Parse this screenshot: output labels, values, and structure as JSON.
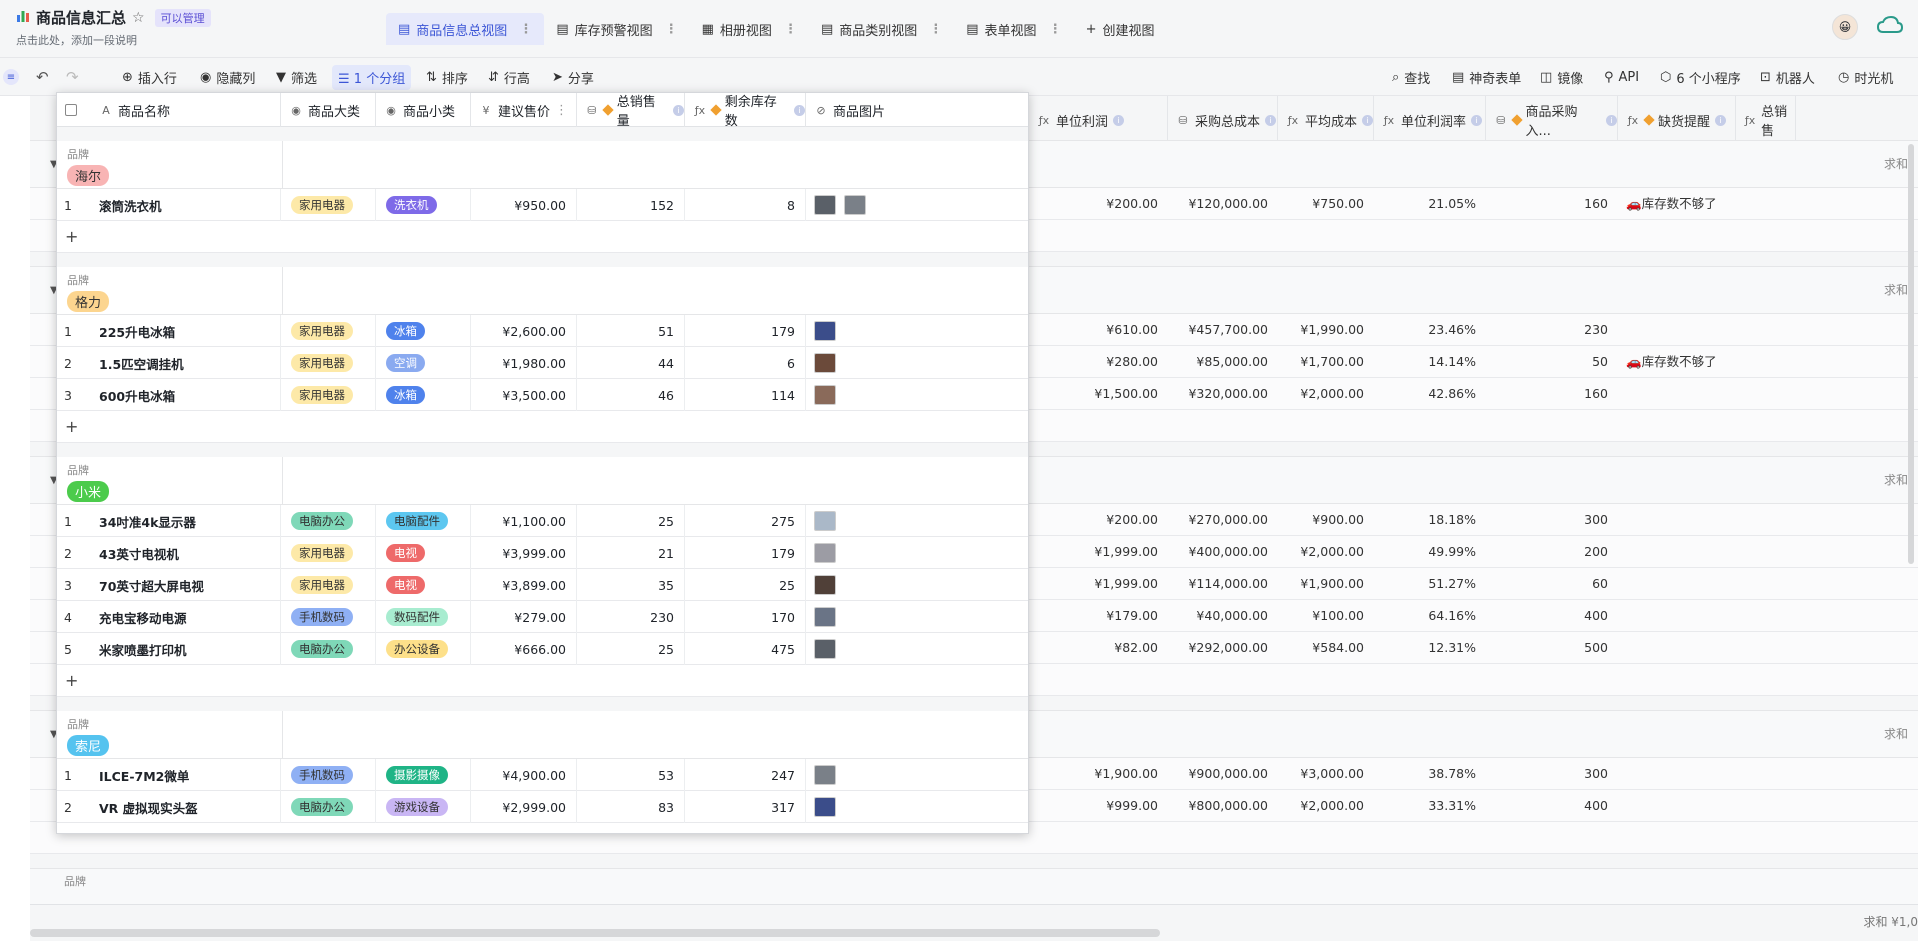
{
  "app": {
    "title": "商品信息汇总",
    "permission": "可以管理",
    "subtitle": "点击此处，添加一段说明"
  },
  "views": [
    {
      "label": "商品信息总视图",
      "active": true
    },
    {
      "label": "库存预警视图",
      "active": false
    },
    {
      "label": "相册视图",
      "active": false
    },
    {
      "label": "商品类别视图",
      "active": false
    },
    {
      "label": "表单视图",
      "active": false
    }
  ],
  "create_view": "创建视图",
  "toolbar": {
    "insert_row": "插入行",
    "hide_cols": "隐藏列",
    "filter": "筛选",
    "group": "1 个分组",
    "sort": "排序",
    "row_height": "行高",
    "share": "分享",
    "find": "查找",
    "magic_form": "神奇表单",
    "mirror": "镜像",
    "api": "API",
    "mini_programs": "6 个小程序",
    "robot": "机器人",
    "time_machine": "时光机"
  },
  "columns": [
    "商品名称",
    "商品大类",
    "商品小类",
    "建议售价",
    "总销售量",
    "剩余库存数",
    "商品图片"
  ],
  "bg_columns": [
    "单位利润",
    "采购总成本",
    "平均成本",
    "单位利润率",
    "商品采购入...",
    "缺货提醒",
    "总销售"
  ],
  "group_label": "品牌",
  "sum_label": "求和",
  "footer_sum": "求和 ¥1,0",
  "groups": [
    {
      "brand": "海尔",
      "rows": [
        {
          "i": "1",
          "name": "滚筒洗衣机",
          "cat": "家用电器",
          "sub": "洗衣机",
          "price": "¥950.00",
          "sold": "152",
          "stock": "8",
          "profit": "¥200.00",
          "cost": "¥120,000.00",
          "avg": "¥750.00",
          "rate": "21.05%",
          "purchase": "160",
          "alert": "🚗库存数不够了哦"
        }
      ]
    },
    {
      "brand": "格力",
      "rows": [
        {
          "i": "1",
          "name": "225升电冰箱",
          "cat": "家用电器",
          "sub": "冰箱",
          "price": "¥2,600.00",
          "sold": "51",
          "stock": "179",
          "profit": "¥610.00",
          "cost": "¥457,700.00",
          "avg": "¥1,990.00",
          "rate": "23.46%",
          "purchase": "230",
          "alert": ""
        },
        {
          "i": "2",
          "name": "1.5匹空调挂机",
          "cat": "家用电器",
          "sub": "空调",
          "price": "¥1,980.00",
          "sold": "44",
          "stock": "6",
          "profit": "¥280.00",
          "cost": "¥85,000.00",
          "avg": "¥1,700.00",
          "rate": "14.14%",
          "purchase": "50",
          "alert": "🚗库存数不够了哦"
        },
        {
          "i": "3",
          "name": "600升电冰箱",
          "cat": "家用电器",
          "sub": "冰箱",
          "price": "¥3,500.00",
          "sold": "46",
          "stock": "114",
          "profit": "¥1,500.00",
          "cost": "¥320,000.00",
          "avg": "¥2,000.00",
          "rate": "42.86%",
          "purchase": "160",
          "alert": ""
        }
      ]
    },
    {
      "brand": "小米",
      "rows": [
        {
          "i": "1",
          "name": "34吋准4k显示器",
          "cat": "电脑办公",
          "sub": "电脑配件",
          "price": "¥1,100.00",
          "sold": "25",
          "stock": "275",
          "profit": "¥200.00",
          "cost": "¥270,000.00",
          "avg": "¥900.00",
          "rate": "18.18%",
          "purchase": "300",
          "alert": ""
        },
        {
          "i": "2",
          "name": "43英寸电视机",
          "cat": "家用电器",
          "sub": "电视",
          "price": "¥3,999.00",
          "sold": "21",
          "stock": "179",
          "profit": "¥1,999.00",
          "cost": "¥400,000.00",
          "avg": "¥2,000.00",
          "rate": "49.99%",
          "purchase": "200",
          "alert": ""
        },
        {
          "i": "3",
          "name": "70英寸超大屏电视",
          "cat": "家用电器",
          "sub": "电视",
          "price": "¥3,899.00",
          "sold": "35",
          "stock": "25",
          "profit": "¥1,999.00",
          "cost": "¥114,000.00",
          "avg": "¥1,900.00",
          "rate": "51.27%",
          "purchase": "60",
          "alert": ""
        },
        {
          "i": "4",
          "name": "充电宝移动电源",
          "cat": "手机数码",
          "sub": "数码配件",
          "price": "¥279.00",
          "sold": "230",
          "stock": "170",
          "profit": "¥179.00",
          "cost": "¥40,000.00",
          "avg": "¥100.00",
          "rate": "64.16%",
          "purchase": "400",
          "alert": ""
        },
        {
          "i": "5",
          "name": "米家喷墨打印机",
          "cat": "电脑办公",
          "sub": "办公设备",
          "price": "¥666.00",
          "sold": "25",
          "stock": "475",
          "profit": "¥82.00",
          "cost": "¥292,000.00",
          "avg": "¥584.00",
          "rate": "12.31%",
          "purchase": "500",
          "alert": ""
        }
      ]
    },
    {
      "brand": "索尼",
      "rows": [
        {
          "i": "1",
          "name": "ILCE-7M2微单",
          "cat": "手机数码",
          "sub": "摄影摄像",
          "price": "¥4,900.00",
          "sold": "53",
          "stock": "247",
          "profit": "¥1,900.00",
          "cost": "¥900,000.00",
          "avg": "¥3,000.00",
          "rate": "38.78%",
          "purchase": "300",
          "alert": ""
        },
        {
          "i": "2",
          "name": "VR 虚拟现实头盔",
          "cat": "电脑办公",
          "sub": "游戏设备",
          "price": "¥2,999.00",
          "sold": "83",
          "stock": "317",
          "profit": "¥999.00",
          "cost": "¥800,000.00",
          "avg": "¥2,000.00",
          "rate": "33.31%",
          "purchase": "400",
          "alert": ""
        }
      ]
    }
  ],
  "colors": {
    "brand": {
      "海尔": "#f8b4b4",
      "格力": "#fcd58f",
      "小米": "#4ccb4c",
      "索尼": "#55c3ef"
    },
    "category": {
      "家用电器": "#fde9a8",
      "电脑办公": "#7fd8b8",
      "手机数码": "#8fb0f4"
    },
    "sub": {
      "洗衣机": "#7e6ae8",
      "冰箱": "#4f82ec",
      "空调": "#8aaaf0",
      "电脑配件": "#5dc7f0",
      "电视": "#ee6a6a",
      "数码配件": "#a8ecd0",
      "办公设备": "#fde08a",
      "摄影摄像": "#1fb486",
      "游戏设备": "#c9b6f4"
    },
    "sub_text_light": [
      "洗衣机",
      "冰箱",
      "电视",
      "摄影摄像",
      "空调"
    ],
    "thumb": [
      "#5a6068",
      "#7a8088",
      "#3b4d8a",
      "#6b4a3a",
      "#8a6a5a",
      "#aab8c8",
      "#9c9ca4",
      "#504038",
      "#6a7486"
    ]
  }
}
